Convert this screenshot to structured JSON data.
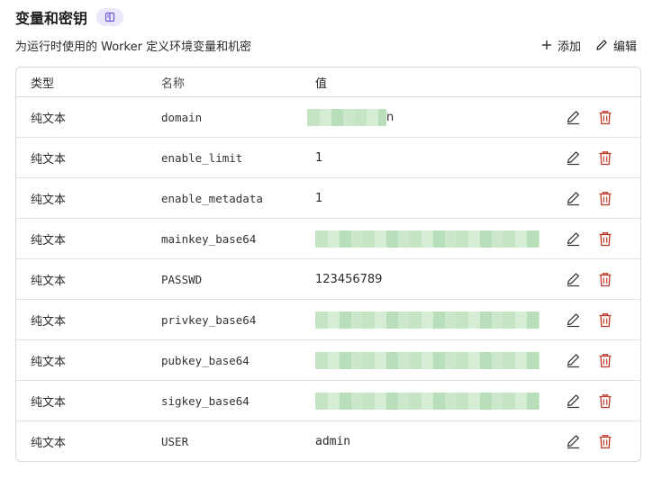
{
  "header": {
    "title": "变量和密钥",
    "description": "为运行时使用的 Worker 定义环境变量和机密",
    "add_label": "添加",
    "edit_label": "编辑"
  },
  "table": {
    "columns": [
      "类型",
      "名称",
      "值"
    ],
    "rows": [
      {
        "type": "纯文本",
        "name": "domain",
        "value": "n",
        "redacted": "short"
      },
      {
        "type": "纯文本",
        "name": "enable_limit",
        "value": "1",
        "redacted": "none"
      },
      {
        "type": "纯文本",
        "name": "enable_metadata",
        "value": "1",
        "redacted": "none"
      },
      {
        "type": "纯文本",
        "name": "mainkey_base64",
        "value": "",
        "redacted": "long"
      },
      {
        "type": "纯文本",
        "name": "PASSWD",
        "value": "123456789",
        "redacted": "none"
      },
      {
        "type": "纯文本",
        "name": "privkey_base64",
        "value": "",
        "redacted": "long"
      },
      {
        "type": "纯文本",
        "name": "pubkey_base64",
        "value": "",
        "redacted": "long"
      },
      {
        "type": "纯文本",
        "name": "sigkey_base64",
        "value": "",
        "redacted": "long"
      },
      {
        "type": "纯文本",
        "name": "USER",
        "value": "admin",
        "redacted": "none"
      }
    ]
  },
  "icons": {
    "doc": "book-icon",
    "add": "plus-icon",
    "edit": "pencil-icon",
    "row_edit": "pencil-icon",
    "row_delete": "trash-icon"
  },
  "colors": {
    "delete": "#c0392b",
    "badge_bg": "#ebe8fb",
    "badge_fg": "#6b5bd6",
    "border": "#d9d9d9"
  }
}
